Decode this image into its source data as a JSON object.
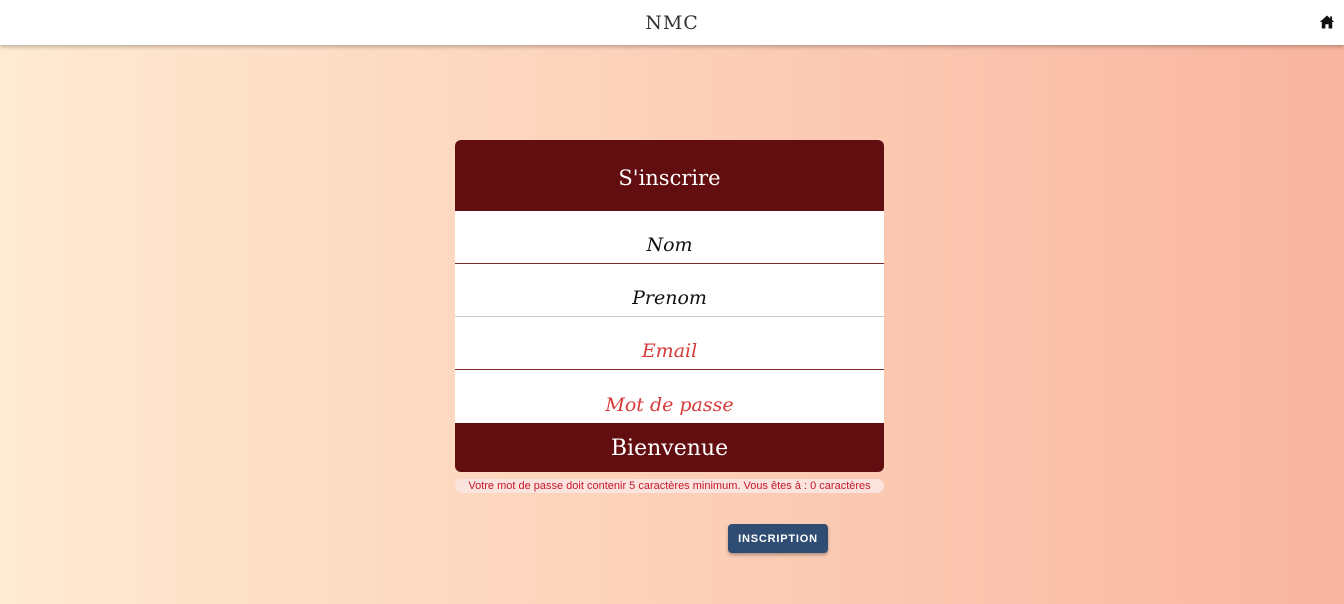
{
  "header": {
    "brand": "NMC",
    "home_icon": "home-icon"
  },
  "form": {
    "title": "S'inscrire",
    "fields": [
      {
        "placeholder": "Nom",
        "value": ""
      },
      {
        "placeholder": "Prenom",
        "value": ""
      },
      {
        "placeholder": "Email",
        "value": ""
      },
      {
        "placeholder": "Mot de passe",
        "value": ""
      }
    ],
    "footer": "Bienvenue",
    "error": "Votre mot de passe doit contenir 5 caractères minimum. Vous êtes à : 0 caractères",
    "submit_label": "INSCRIPTION"
  },
  "colors": {
    "card_accent": "#620d10",
    "button": "#2f4d72",
    "error_text": "#c5182a",
    "placeholder_red": "#d73a3a"
  }
}
